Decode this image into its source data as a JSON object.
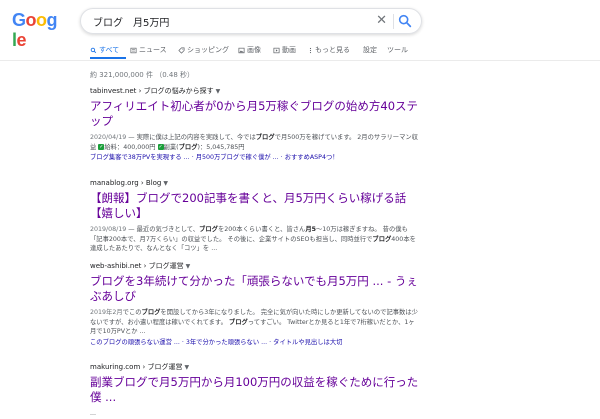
{
  "logo": {
    "letters": [
      "G",
      "o",
      "o",
      "g",
      "l",
      "e"
    ],
    "colors": [
      "#4285f4",
      "#ea4335",
      "#fbbc05",
      "#4285f4",
      "#34a853",
      "#ea4335"
    ]
  },
  "search": {
    "query": "ブログ　月5万円"
  },
  "tabs": [
    {
      "label": "すべて",
      "icon": "search-icon"
    },
    {
      "label": "ニュース",
      "icon": "news-icon"
    },
    {
      "label": "ショッピング",
      "icon": "tag-icon"
    },
    {
      "label": "画像",
      "icon": "image-icon"
    },
    {
      "label": "動画",
      "icon": "play-icon"
    },
    {
      "label": "もっと見る",
      "icon": "more-icon"
    },
    {
      "label": "設定",
      "icon": ""
    },
    {
      "label": "ツール",
      "icon": ""
    }
  ],
  "stats": "約 321,000,000 件 （0.48 秒）",
  "results": [
    {
      "cite": "tabinvest.net › ブログの悩みから探す",
      "title": "アフィリエイト初心者が0から月5万稼ぐブログの始め方40ステップ",
      "date": "2020/04/19",
      "snippet_html": "実際に僕は上記の内容を実践して、今では<b>ブログ</b>で月500万を稼げています。 2月のサラリーマン収益 ✅給料：400,000円 ✅副業(<b>ブログ</b>)：5,045,785円",
      "sitelinks": "ブログ集客で38万PVを実現する ... · 月500万ブログで稼ぐ僕が ... · おすすめASP4つ！"
    },
    {
      "cite": "manablog.org › Blog",
      "title": "【朗報】ブログで200記事を書くと、月5万円くらい稼げる話【嬉しい】",
      "date": "2019/08/19",
      "snippet_html": "最近の気づきとして、<b>ブログ</b>を200本くらい書くと、皆さん<b>月5</b>〜10万は稼ぎますね。 昔の僕も「記事200本で、月7万くらい」の収益でした。 その後に、企業サイトのSEOも担当し、同時並行で<b>ブログ</b>400本を達成したあたりで、なんとなく「コツ」を ...",
      "sitelinks": ""
    },
    {
      "cite": "web-ashibi.net › ブログ運営",
      "title": "ブログを3年続けて分かった「頑張らないでも月5万円 ... - うぇぶあしび",
      "date": "2019年2月",
      "snippet_html": "でこの<b>ブログ</b>を開設してから3年になりました。 完全に気が向いた時にしか更新してないので記事数は少ないですが、お小遣い程度は稼いでくれてます。 <b>ブログ</b>ってすごい。 Twitterとか見ると1年で7桁稼いだとか、1ヶ月で10万PVとか ...",
      "sitelinks": "このブログの頑張らない運営 ... · 3年で分かった頑張らない ... · タイトルや見出しは大切"
    },
    {
      "cite": "makuring.com › ブログ運営",
      "title": "副業ブログで月5万円から月100万円の収益を稼ぐために行った僕 ...",
      "date": "",
      "snippet_html": "",
      "sitelinks": ""
    }
  ]
}
